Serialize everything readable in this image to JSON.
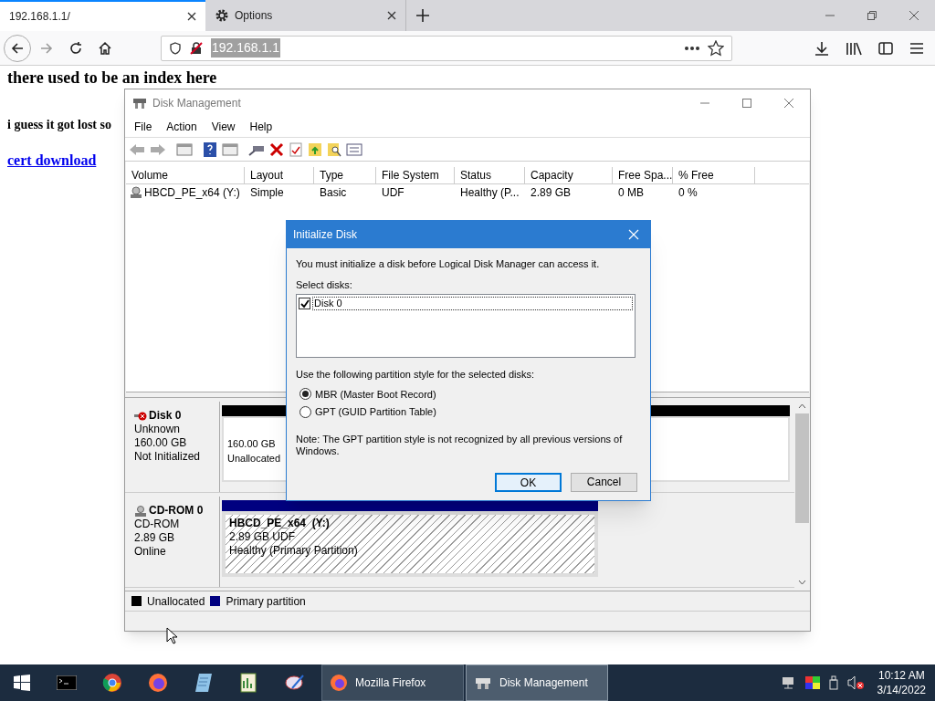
{
  "browser": {
    "tabs": [
      {
        "label": "192.168.1.1/",
        "kind": "page",
        "selected": true
      },
      {
        "label": "Options",
        "kind": "settings",
        "selected": false
      }
    ],
    "address": "192.168.1.1"
  },
  "page": {
    "heading": "there used to be an index here",
    "text": "i guess it got lost so",
    "link": "cert download"
  },
  "disk_management": {
    "title": "Disk Management",
    "menu": [
      "File",
      "Action",
      "View",
      "Help"
    ],
    "columns": [
      "Volume",
      "Layout",
      "Type",
      "File System",
      "Status",
      "Capacity",
      "Free Spa...",
      "% Free"
    ],
    "rows": [
      [
        "HBCD_PE_x64 (Y:)",
        "Simple",
        "Basic",
        "UDF",
        "Healthy (P...",
        "2.89 GB",
        "0 MB",
        "0 %"
      ]
    ],
    "disks": [
      {
        "name": "Disk 0",
        "kind": "disk",
        "type": "Unknown",
        "size": "160.00 GB",
        "status": "Not Initialized",
        "partitions": [
          {
            "kind": "unallocated",
            "lines": [
              "160.00 GB",
              "Unallocated"
            ]
          }
        ]
      },
      {
        "name": "CD-ROM 0",
        "kind": "cdrom",
        "type": "CD-ROM",
        "size": "2.89 GB",
        "status": "Online",
        "partitions": [
          {
            "kind": "primary",
            "name": "HBCD_PE_x64  (Y:)",
            "lines": [
              "2.89 GB UDF",
              "Healthy (Primary Partition)"
            ]
          }
        ]
      }
    ],
    "legend": [
      {
        "label": "Unallocated",
        "color": "#000000"
      },
      {
        "label": "Primary partition",
        "color": "#000080"
      }
    ]
  },
  "dialog": {
    "title": "Initialize Disk",
    "message": "You must initialize a disk before Logical Disk Manager can access it.",
    "select_label": "Select disks:",
    "disks": [
      {
        "label": "Disk 0",
        "checked": true
      }
    ],
    "style_label": "Use the following partition style for the selected disks:",
    "options": [
      {
        "label": "MBR (Master Boot Record)",
        "selected": true
      },
      {
        "label": "GPT (GUID Partition Table)",
        "selected": false
      }
    ],
    "note": "Note: The GPT partition style is not recognized by all previous versions of Windows.",
    "buttons": [
      {
        "label": "OK",
        "default": true
      },
      {
        "label": "Cancel",
        "default": false
      }
    ]
  },
  "taskbar": {
    "tasks": [
      {
        "label": "Mozilla Firefox",
        "kind": "firefox",
        "selected": false
      },
      {
        "label": "Disk Management",
        "kind": "disk",
        "selected": true
      }
    ],
    "time": "10:12 AM",
    "date": "3/14/2022"
  }
}
